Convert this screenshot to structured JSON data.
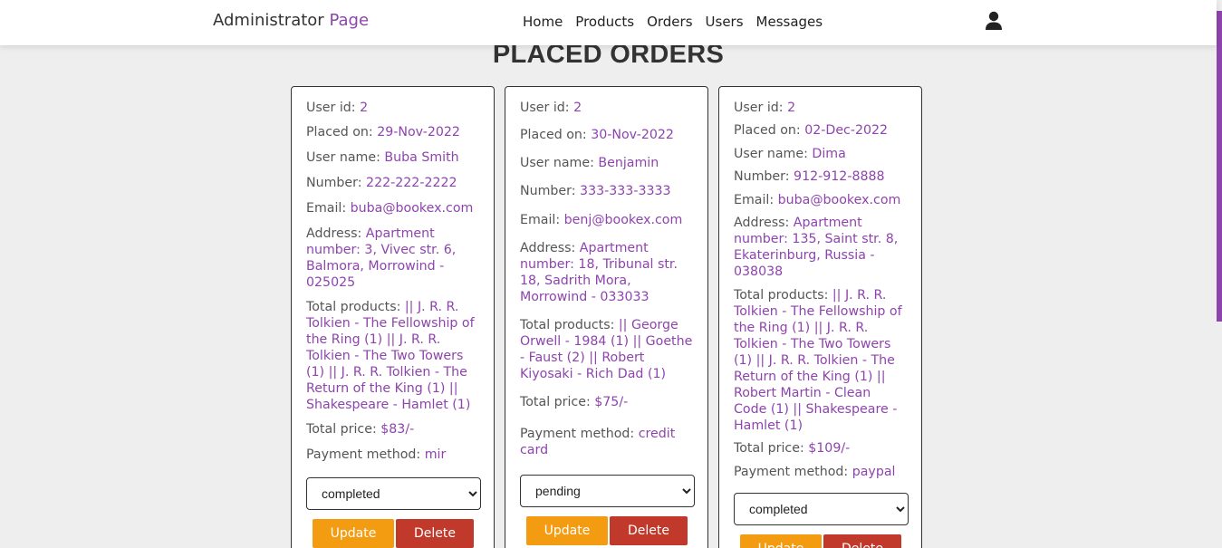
{
  "header": {
    "logo_main": "Administrator",
    "logo_accent": "Page",
    "nav": [
      "Home",
      "Products",
      "Orders",
      "Users",
      "Messages"
    ]
  },
  "title": "PLACED ORDERS",
  "colors": {
    "accent": "#8e44ad",
    "update": "#f39c12",
    "delete": "#c0392b"
  },
  "labels": {
    "user_id": "User id:",
    "placed_on": "Placed on:",
    "user_name": "User name:",
    "number": "Number:",
    "email": "Email:",
    "address": "Address:",
    "total_products": "Total products:",
    "total_price": "Total price:",
    "payment": "Payment method:",
    "update": "Update",
    "delete": "Delete"
  },
  "orders": [
    {
      "user_id": "2",
      "placed_on": "29-Nov-2022",
      "user_name": "Buba Smith",
      "number": "222-222-2222",
      "email": "buba@bookex.com",
      "address": "Apartment number: 3, Vivec str. 6, Balmora, Morrowind - 025025",
      "total_products": "|| J. R. R. Tolkien - The Fellowship of the Ring (1) || J. R. R. Tolkien - The Two Towers (1) || J. R. R. Tolkien - The Return of the King (1) || Shakespeare - Hamlet (1)",
      "total_price": "$83/-",
      "payment": "mir",
      "status": "completed"
    },
    {
      "user_id": "2",
      "placed_on": "30-Nov-2022",
      "user_name": "Benjamin",
      "number": "333-333-3333",
      "email": "benj@bookex.com",
      "address": "Apartment number: 18, Tribunal str. 18, Sadrith Mora, Morrowind - 033033",
      "total_products": "|| George Orwell - 1984 (1) || Goethe - Faust (2) || Robert Kiyosaki - Rich Dad (1)",
      "total_price": "$75/-",
      "payment": "credit card",
      "status": "pending"
    },
    {
      "user_id": "2",
      "placed_on": "02-Dec-2022",
      "user_name": "Dima",
      "number": "912-912-8888",
      "email": "buba@bookex.com",
      "address": "Apartment number: 135, Saint str. 8, Ekaterinburg, Russia - 038038",
      "total_products": "|| J. R. R. Tolkien - The Fellowship of the Ring (1) || J. R. R. Tolkien - The Two Towers (1) || J. R. R. Tolkien - The Return of the King (1) || Robert Martin - Clean Code (1) || Shakespeare - Hamlet (1)",
      "total_price": "$109/-",
      "payment": "paypal",
      "status": "completed"
    }
  ]
}
